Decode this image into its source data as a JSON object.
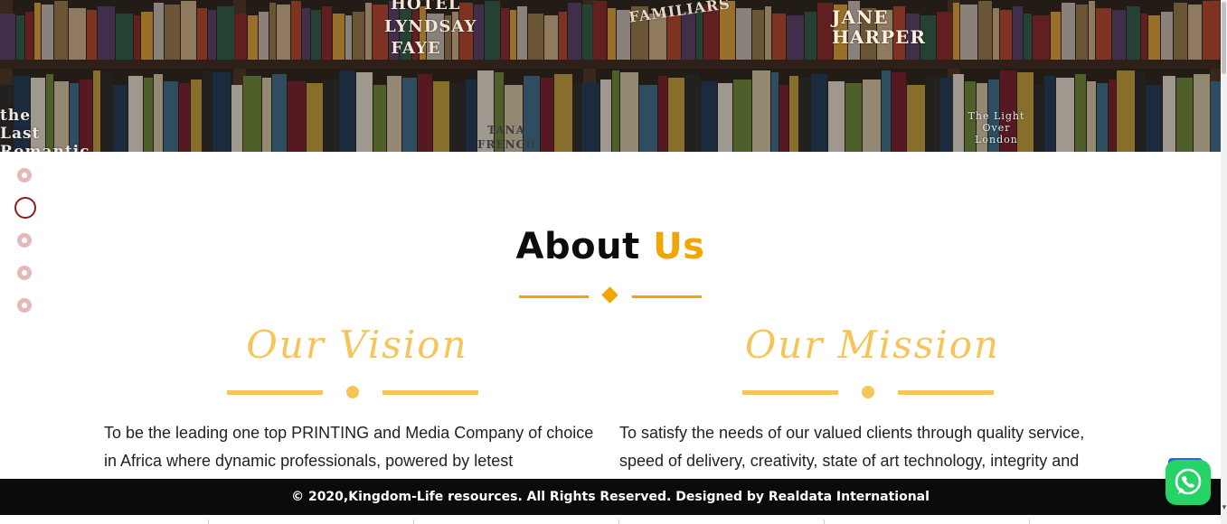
{
  "hero": {
    "book_titles": [
      "FAMILIARS",
      "JANE HARPER",
      "LYNDSAY FAYE",
      "HOTEL",
      "TANA FRENCH",
      "the Last Romantic",
      "The Light Over London"
    ]
  },
  "dot_nav": {
    "count": 5,
    "active_index": 1
  },
  "about": {
    "title_main": "About",
    "title_accent": "Us",
    "accent_color": "#f0a500"
  },
  "vision": {
    "title": "Our Vision",
    "text": "To be the leading one top PRINTING and Media Company of choice in Africa where dynamic professionals, powered by letest"
  },
  "mission": {
    "title": "Our Mission",
    "text": "To satisfy the needs of our valued clients through quality service, speed of delivery, creativity, state of art technology, integrity and"
  },
  "footer": {
    "text": "© 2020,Kingdom-Life resources. All Rights Reserved. Designed by Realdata International"
  },
  "floating": {
    "whatsapp_icon": "whatsapp-icon",
    "whatsapp_color": "#25d366"
  }
}
